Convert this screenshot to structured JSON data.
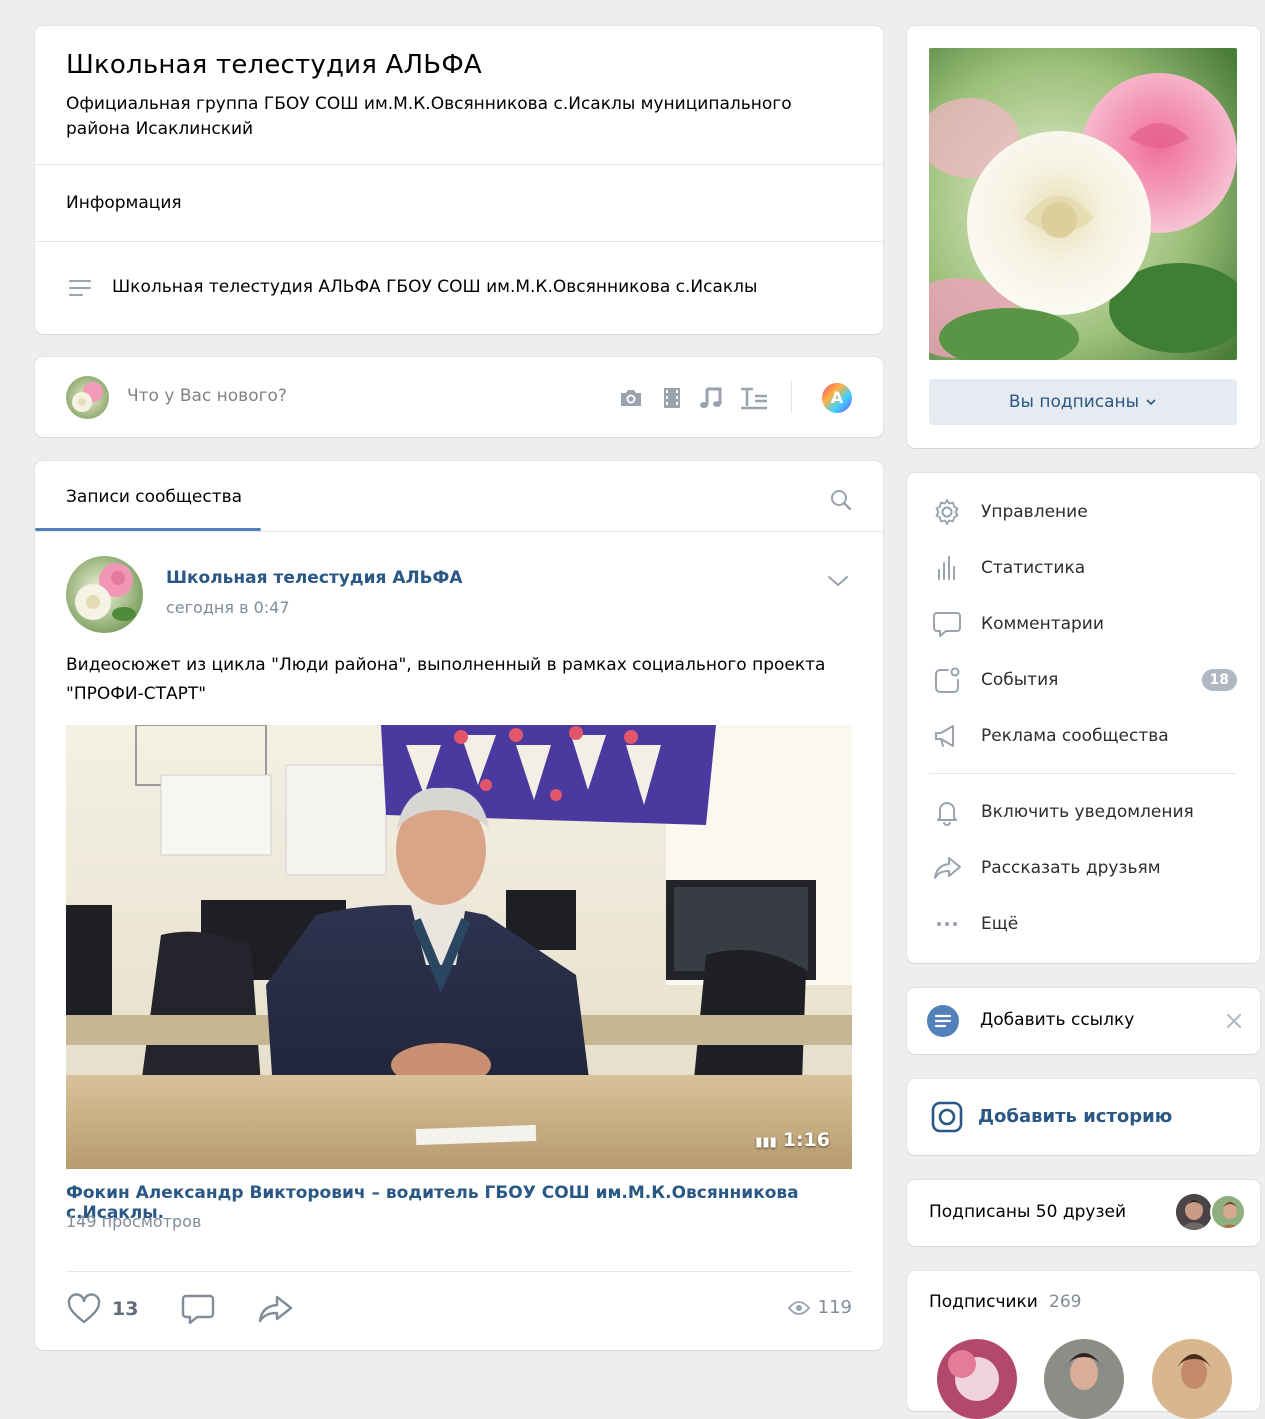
{
  "header": {
    "title": "Школьная телестудия АЛЬФА",
    "description": "Официальная группа ГБОУ СОШ им.М.К.Овсянникова с.Исаклы муниципального района Исаклинский",
    "info_label": "Информация",
    "info_text": "Школьная телестудия АЛЬФА ГБОУ СОШ им.М.К.Овсянникова с.Исаклы"
  },
  "composer": {
    "placeholder": "Что у Вас нового?",
    "tools": [
      "camera-icon",
      "video-icon",
      "music-icon",
      "text-icon"
    ],
    "ai_label": "A"
  },
  "wall": {
    "tab_label": "Записи сообщества",
    "post": {
      "author": "Школьная телестудия АЛЬФА",
      "time": "сегодня в 0:47",
      "text": "Видеосюжет из цикла \"Люди района\", выполненный в рамках социального проекта \"ПРОФИ-СТАРТ\"",
      "video": {
        "duration": "1:16",
        "title": "Фокин Александр Викторович – водитель ГБОУ СОШ им.М.К.Овсянникова с.Исаклы.",
        "views": "149 просмотров"
      },
      "likes": "13",
      "views": "119"
    }
  },
  "sidebar": {
    "subscribed_button": "Вы подписаны",
    "menu": [
      {
        "label": "Управление",
        "icon": "gear-icon"
      },
      {
        "label": "Статистика",
        "icon": "stats-icon"
      },
      {
        "label": "Комментарии",
        "icon": "comment-icon"
      },
      {
        "label": "События",
        "icon": "events-icon",
        "badge": "18"
      },
      {
        "label": "Реклама сообщества",
        "icon": "megaphone-icon"
      },
      {
        "label": "Включить уведомления",
        "icon": "bell-icon"
      },
      {
        "label": "Рассказать друзьям",
        "icon": "share-icon"
      },
      {
        "label": "Ещё",
        "icon": "more-icon"
      }
    ],
    "add_link": "Добавить ссылку",
    "add_story": "Добавить историю",
    "friends_subscribed": "Подписаны 50 друзей",
    "subscribers_label": "Подписчики",
    "subscribers_count": "269"
  },
  "colors": {
    "accent": "#5181b8",
    "link": "#2a5885",
    "muted": "#818c99",
    "background": "#edeef0"
  }
}
